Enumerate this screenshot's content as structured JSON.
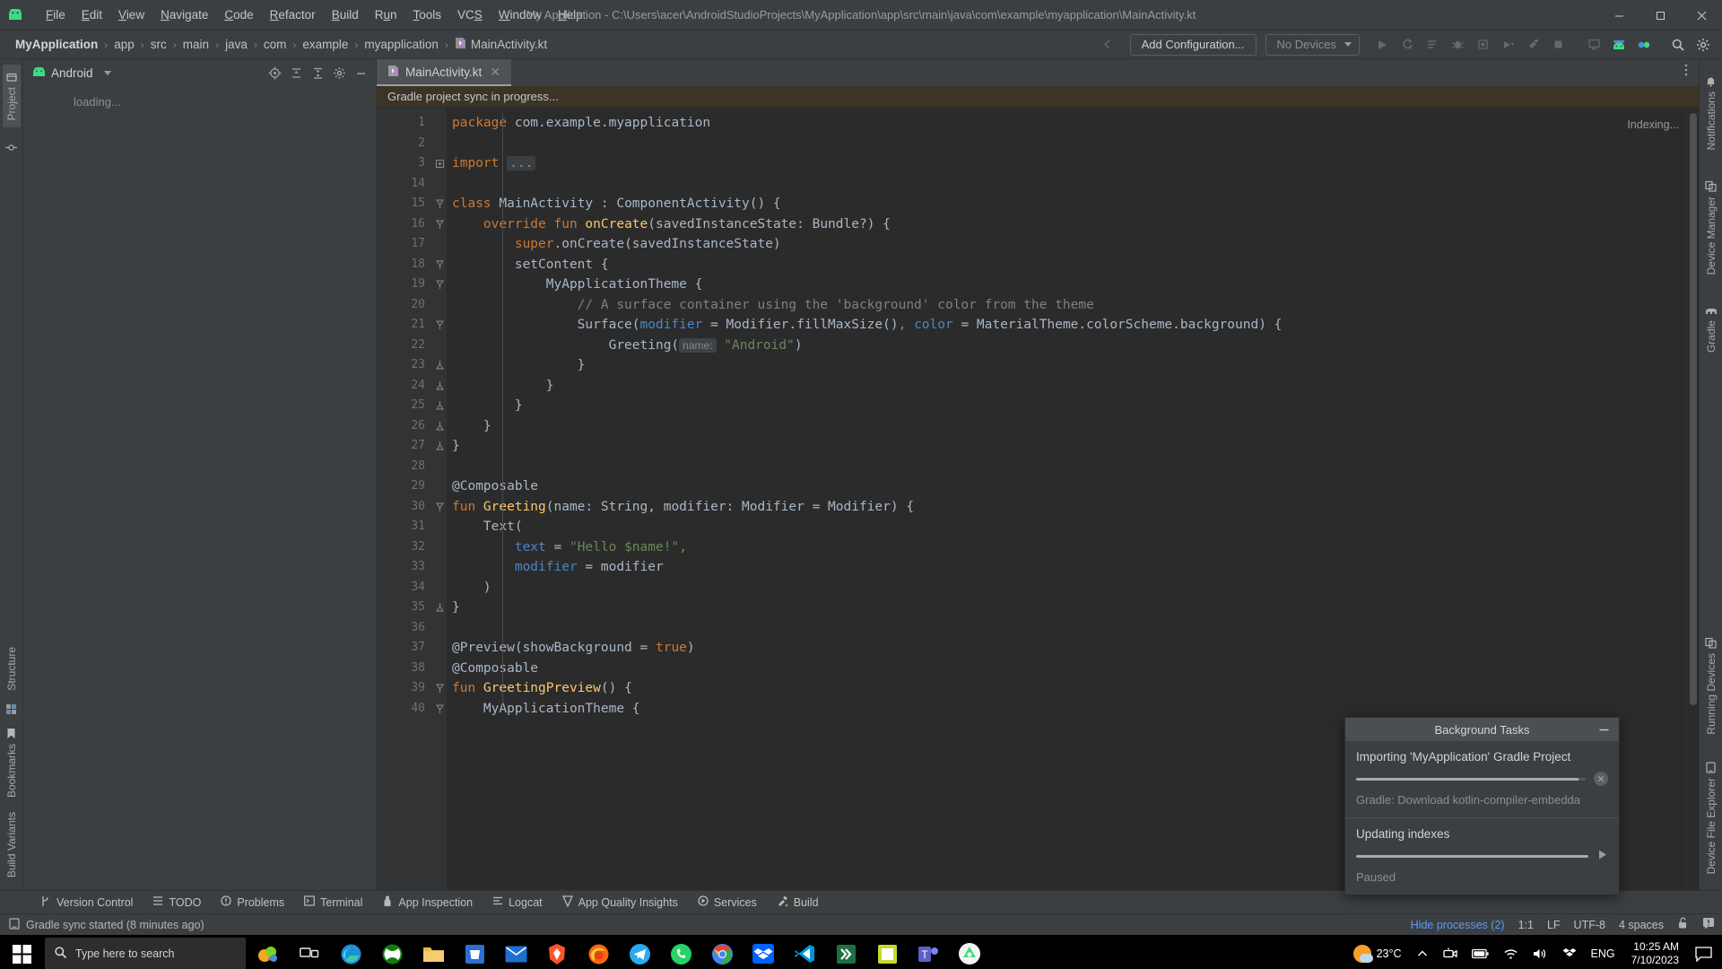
{
  "titlebar": {
    "title": "My Application - C:\\Users\\acer\\AndroidStudioProjects\\MyApplication\\app\\src\\main\\java\\com\\example\\myapplication\\MainActivity.kt",
    "logo_icon": "android-robot-icon",
    "menu": [
      {
        "label": "File",
        "mnemonic": "F"
      },
      {
        "label": "Edit",
        "mnemonic": "E"
      },
      {
        "label": "View",
        "mnemonic": "V"
      },
      {
        "label": "Navigate",
        "mnemonic": "N"
      },
      {
        "label": "Code",
        "mnemonic": "C"
      },
      {
        "label": "Refactor",
        "mnemonic": "R"
      },
      {
        "label": "Build",
        "mnemonic": "B"
      },
      {
        "label": "Run",
        "mnemonic": "u"
      },
      {
        "label": "Tools",
        "mnemonic": "T"
      },
      {
        "label": "VCS",
        "mnemonic": "S"
      },
      {
        "label": "Window",
        "mnemonic": "W"
      },
      {
        "label": "Help",
        "mnemonic": "H"
      }
    ],
    "window_controls": [
      {
        "name": "minimize",
        "glyph": "—"
      },
      {
        "name": "maximize",
        "glyph": "❐"
      },
      {
        "name": "close",
        "glyph": "✕"
      }
    ]
  },
  "navbar": {
    "breadcrumbs": [
      {
        "label": "MyApplication",
        "bold": true
      },
      {
        "label": "app"
      },
      {
        "label": "src"
      },
      {
        "label": "main"
      },
      {
        "label": "java"
      },
      {
        "label": "com"
      },
      {
        "label": "example"
      },
      {
        "label": "myapplication"
      },
      {
        "label": "MainActivity.kt",
        "icon": "kotlin-file-icon"
      }
    ],
    "separator": "›",
    "back_icon": "back-arrow-icon",
    "add_configuration_label": "Add Configuration...",
    "device_selector_label": "No Devices",
    "toolbar_icons": [
      "run-icon",
      "coverage-icon",
      "profile-icon",
      "debug-icon",
      "attach-debugger-icon",
      "more-run-icon",
      "build-icon",
      "stop-icon",
      "avd-manager-icon",
      "sdk-manager-icon",
      "device-manager-icon",
      "search-icon",
      "settings-icon"
    ]
  },
  "left_strip": {
    "top": [
      {
        "label": "Project",
        "icon": "project-icon",
        "selected": true
      },
      {
        "label": "",
        "icon": "commit-icon",
        "selected": false
      }
    ],
    "bottom": [
      {
        "label": "Structure",
        "icon": "structure-icon"
      },
      {
        "label": "",
        "icon": "build-variants-small-icon"
      },
      {
        "label": "Bookmarks",
        "icon": "bookmark-icon"
      },
      {
        "label": "Build Variants",
        "icon": "build-variants-icon"
      }
    ]
  },
  "right_strip": {
    "items": [
      {
        "label": "Notifications",
        "icon": "bell-icon"
      },
      {
        "label": "Device Manager",
        "icon": "device-manager-icon"
      },
      {
        "label": "Gradle",
        "icon": "gradle-elephant-icon"
      },
      {
        "label": "Running Devices",
        "icon": "running-devices-icon"
      },
      {
        "label": "Device File Explorer",
        "icon": "device-file-explorer-icon"
      }
    ]
  },
  "project_panel": {
    "title": "Android",
    "title_icon": "android-head-icon",
    "dropdown_icon": "chevron-down-icon",
    "header_buttons": [
      {
        "name": "select-opened-file",
        "icon": "target-icon"
      },
      {
        "name": "expand-all",
        "icon": "expand-all-icon"
      },
      {
        "name": "collapse-all",
        "icon": "collapse-all-icon"
      },
      {
        "name": "settings",
        "icon": "gear-icon"
      },
      {
        "name": "hide",
        "icon": "minimize-icon"
      }
    ],
    "loading_text": "loading..."
  },
  "editor": {
    "tabs": [
      {
        "label": "MainActivity.kt",
        "icon": "kotlin-file-icon",
        "active": true,
        "close_icon": "close-icon"
      }
    ],
    "kebab_icon": "more-options-icon",
    "sync_banner": "Gradle project sync in progress...",
    "indexing_label": "Indexing...",
    "lines": [
      {
        "num": "1",
        "fold": "",
        "tokens": [
          {
            "t": "package ",
            "c": "kw"
          },
          {
            "t": "com.example.myapplication",
            "c": "plain"
          }
        ]
      },
      {
        "num": "2",
        "fold": "",
        "tokens": []
      },
      {
        "num": "3",
        "fold": "+",
        "tokens": [
          {
            "t": "import ",
            "c": "kw"
          },
          {
            "t": "...",
            "c": "fold"
          }
        ]
      },
      {
        "num": "14",
        "fold": "",
        "tokens": []
      },
      {
        "num": "15",
        "fold": "v",
        "tokens": [
          {
            "t": "class ",
            "c": "kw"
          },
          {
            "t": "MainActivity : ComponentActivity() {",
            "c": "plain"
          }
        ]
      },
      {
        "num": "16",
        "fold": "v",
        "tokens": [
          {
            "t": "    ",
            "c": "plain"
          },
          {
            "t": "override fun ",
            "c": "kw"
          },
          {
            "t": "onCreate",
            "c": "fn"
          },
          {
            "t": "(savedInstanceState: Bundle?) {",
            "c": "plain"
          }
        ]
      },
      {
        "num": "17",
        "fold": "",
        "tokens": [
          {
            "t": "        ",
            "c": "plain"
          },
          {
            "t": "super",
            "c": "kw"
          },
          {
            "t": ".onCreate(savedInstanceState)",
            "c": "plain"
          }
        ]
      },
      {
        "num": "18",
        "fold": "v",
        "tokens": [
          {
            "t": "        setContent {",
            "c": "plain"
          }
        ]
      },
      {
        "num": "19",
        "fold": "v",
        "tokens": [
          {
            "t": "            MyApplicationTheme {",
            "c": "plain"
          }
        ]
      },
      {
        "num": "20",
        "fold": "",
        "tokens": [
          {
            "t": "                // A surface container using the 'background' color from the theme",
            "c": "cmt"
          }
        ]
      },
      {
        "num": "21",
        "fold": "v",
        "tokens": [
          {
            "t": "                Surface(",
            "c": "plain"
          },
          {
            "t": "modifier",
            "c": "named"
          },
          {
            "t": " = Modifier.fillMaxSize()",
            "c": "plain"
          },
          {
            "t": ", ",
            "c": "kw"
          },
          {
            "t": "color",
            "c": "named"
          },
          {
            "t": " = MaterialTheme.colorScheme.background) {",
            "c": "plain"
          }
        ]
      },
      {
        "num": "22",
        "fold": "",
        "tokens": [
          {
            "t": "                    Greeting(",
            "c": "plain"
          },
          {
            "t": "name:",
            "c": "hint"
          },
          {
            "t": " ",
            "c": "plain"
          },
          {
            "t": "\"Android\"",
            "c": "str"
          },
          {
            "t": ")",
            "c": "plain"
          }
        ]
      },
      {
        "num": "23",
        "fold": "^",
        "tokens": [
          {
            "t": "                }",
            "c": "plain"
          }
        ]
      },
      {
        "num": "24",
        "fold": "^",
        "tokens": [
          {
            "t": "            }",
            "c": "plain"
          }
        ]
      },
      {
        "num": "25",
        "fold": "^",
        "tokens": [
          {
            "t": "        }",
            "c": "plain"
          }
        ]
      },
      {
        "num": "26",
        "fold": "^",
        "tokens": [
          {
            "t": "    }",
            "c": "plain"
          }
        ]
      },
      {
        "num": "27",
        "fold": "^",
        "tokens": [
          {
            "t": "}",
            "c": "plain"
          }
        ]
      },
      {
        "num": "28",
        "fold": "",
        "tokens": []
      },
      {
        "num": "29",
        "fold": "",
        "tokens": [
          {
            "t": "@Composable",
            "c": "plain"
          }
        ]
      },
      {
        "num": "30",
        "fold": "v",
        "tokens": [
          {
            "t": "fun ",
            "c": "kw"
          },
          {
            "t": "Greeting",
            "c": "fn"
          },
          {
            "t": "(name: String, modifier: Modifier = Modifier) {",
            "c": "plain"
          }
        ]
      },
      {
        "num": "31",
        "fold": "",
        "tokens": [
          {
            "t": "    Text(",
            "c": "plain"
          }
        ]
      },
      {
        "num": "32",
        "fold": "",
        "tokens": [
          {
            "t": "        ",
            "c": "plain"
          },
          {
            "t": "text",
            "c": "named"
          },
          {
            "t": " = ",
            "c": "plain"
          },
          {
            "t": "\"Hello $name!\"",
            "c": "str"
          },
          {
            "t": ",",
            "c": "kw"
          }
        ]
      },
      {
        "num": "33",
        "fold": "",
        "tokens": [
          {
            "t": "        ",
            "c": "plain"
          },
          {
            "t": "modifier",
            "c": "named"
          },
          {
            "t": " = modifier",
            "c": "plain"
          }
        ]
      },
      {
        "num": "34",
        "fold": "",
        "tokens": [
          {
            "t": "    )",
            "c": "plain"
          }
        ]
      },
      {
        "num": "35",
        "fold": "^",
        "tokens": [
          {
            "t": "}",
            "c": "plain"
          }
        ]
      },
      {
        "num": "36",
        "fold": "",
        "tokens": []
      },
      {
        "num": "37",
        "fold": "",
        "tokens": [
          {
            "t": "@Preview(showBackground = ",
            "c": "plain"
          },
          {
            "t": "true",
            "c": "kw"
          },
          {
            "t": ")",
            "c": "plain"
          }
        ]
      },
      {
        "num": "38",
        "fold": "",
        "tokens": [
          {
            "t": "@Composable",
            "c": "plain"
          }
        ]
      },
      {
        "num": "39",
        "fold": "v",
        "tokens": [
          {
            "t": "fun ",
            "c": "kw"
          },
          {
            "t": "GreetingPreview",
            "c": "fn"
          },
          {
            "t": "() {",
            "c": "plain"
          }
        ]
      },
      {
        "num": "40",
        "fold": "v",
        "tokens": [
          {
            "t": "    MyApplicationTheme {",
            "c": "plain"
          }
        ]
      }
    ]
  },
  "background_tasks": {
    "title": "Background Tasks",
    "minimize_icon": "minimize-icon",
    "tasks": [
      {
        "title": "Importing 'MyApplication' Gradle Project",
        "subtitle": "Gradle: Download kotlin-compiler-embedda",
        "progress": 97,
        "action_icon": "cancel-icon"
      },
      {
        "title": "Updating indexes",
        "subtitle": "Paused",
        "progress": 100,
        "action_icon": "resume-icon"
      }
    ]
  },
  "tool_window_bar": {
    "items": [
      {
        "label": "Version Control",
        "icon": "branch-icon"
      },
      {
        "label": "TODO",
        "icon": "todo-icon"
      },
      {
        "label": "Problems",
        "icon": "problems-icon"
      },
      {
        "label": "Terminal",
        "icon": "terminal-icon"
      },
      {
        "label": "App Inspection",
        "icon": "app-inspection-icon"
      },
      {
        "label": "Logcat",
        "icon": "logcat-icon"
      },
      {
        "label": "App Quality Insights",
        "icon": "app-quality-icon"
      },
      {
        "label": "Services",
        "icon": "services-icon"
      },
      {
        "label": "Build",
        "icon": "build-hammer-icon"
      }
    ]
  },
  "statusbar": {
    "message_icon": "event-log-icon",
    "message": "Gradle sync started (8 minutes ago)",
    "hide_processes": "Hide processes (2)",
    "caret_position": "1:1",
    "line_separator": "LF",
    "encoding": "UTF-8",
    "indent": "4 spaces",
    "lock_icon": "unlock-icon",
    "notification_icon": "notification-icon"
  },
  "taskbar": {
    "start_icon": "windows-start-icon",
    "search_placeholder": "Type here to search",
    "search_icon": "search-icon",
    "apps": [
      {
        "name": "task-view",
        "icon": "task-view-icon"
      },
      {
        "name": "edge",
        "icon": "edge-icon"
      },
      {
        "name": "xbox",
        "icon": "xbox-icon"
      },
      {
        "name": "file-explorer",
        "icon": "folder-icon"
      },
      {
        "name": "store",
        "icon": "store-icon"
      },
      {
        "name": "mail",
        "icon": "mail-icon"
      },
      {
        "name": "brave",
        "icon": "brave-icon"
      },
      {
        "name": "firefox",
        "icon": "firefox-icon"
      },
      {
        "name": "telegram",
        "icon": "telegram-icon"
      },
      {
        "name": "whatsapp",
        "icon": "whatsapp-icon"
      },
      {
        "name": "chrome",
        "icon": "chrome-icon"
      },
      {
        "name": "dropbox",
        "icon": "dropbox-icon"
      },
      {
        "name": "vscode",
        "icon": "vscode-icon"
      },
      {
        "name": "excel",
        "icon": "excel-icon"
      },
      {
        "name": "notes",
        "icon": "notes-icon"
      },
      {
        "name": "teams",
        "icon": "teams-icon"
      },
      {
        "name": "android-studio",
        "icon": "android-studio-icon",
        "active": true
      }
    ],
    "tray": {
      "weather_temp": "23°C",
      "weather_icon": "sun-cloud-icon",
      "chevron_icon": "chevron-up-icon",
      "icons": [
        "camera-icon",
        "battery-icon",
        "wifi-icon",
        "volume-icon",
        "dropbox-tray-icon"
      ],
      "language": "ENG",
      "time": "10:25 AM",
      "date": "7/10/2023",
      "action_center_icon": "speech-bubble-icon"
    }
  },
  "colors": {
    "accent_blue": "#589df6",
    "editor_bg": "#2b2b2b",
    "chrome_bg": "#3c3f41",
    "banner_bg": "#3b3427",
    "keyword_orange": "#cc7832",
    "string_green": "#6a8759",
    "function_yellow": "#ffc66d",
    "named_param_blue": "#4a86c8"
  }
}
